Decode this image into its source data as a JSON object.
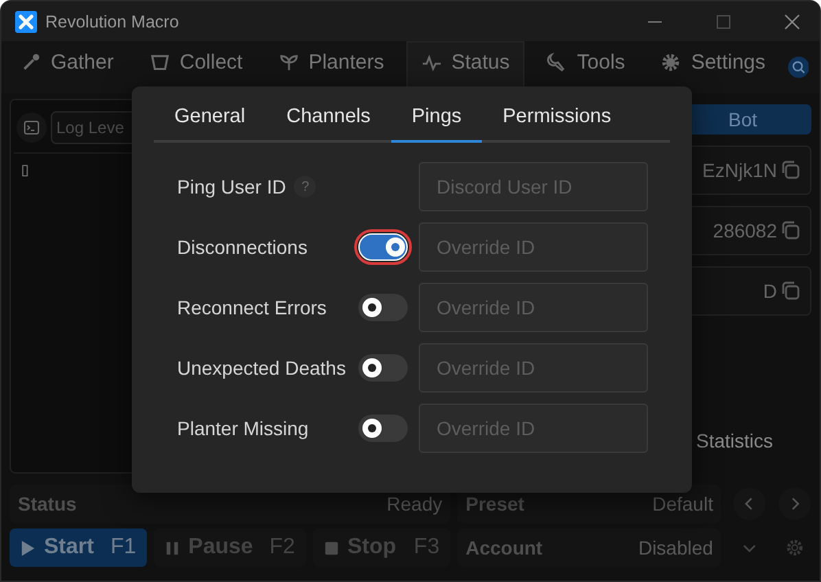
{
  "window": {
    "title": "Revolution Macro"
  },
  "main_tabs": [
    {
      "label": "Gather",
      "selected": false
    },
    {
      "label": "Collect",
      "selected": false
    },
    {
      "label": "Planters",
      "selected": false
    },
    {
      "label": "Status",
      "selected": true
    },
    {
      "label": "Tools",
      "selected": false
    },
    {
      "label": "Settings",
      "selected": false
    }
  ],
  "console": {
    "log_level_placeholder": "Log Leve",
    "output": "▯"
  },
  "bot_panel": {
    "button": "Bot",
    "fields": [
      {
        "value": "EzNjk1N"
      },
      {
        "value": "286082"
      },
      {
        "value": "D"
      }
    ],
    "statistics": "Statistics"
  },
  "dialog": {
    "tabs": [
      {
        "label": "General",
        "selected": false
      },
      {
        "label": "Channels",
        "selected": false
      },
      {
        "label": "Pings",
        "selected": true
      },
      {
        "label": "Permissions",
        "selected": false
      }
    ],
    "rows": [
      {
        "kind": "help",
        "label": "Ping User ID",
        "help": "?",
        "placeholder": "Discord User ID"
      },
      {
        "kind": "toggle",
        "label": "Disconnections",
        "on": true,
        "focused": true,
        "placeholder": "Override ID"
      },
      {
        "kind": "toggle",
        "label": "Reconnect Errors",
        "on": false,
        "focused": false,
        "placeholder": "Override ID"
      },
      {
        "kind": "toggle",
        "label": "Unexpected Deaths",
        "on": false,
        "focused": false,
        "placeholder": "Override ID"
      },
      {
        "kind": "toggle",
        "label": "Planter Missing",
        "on": false,
        "focused": false,
        "placeholder": "Override ID"
      }
    ]
  },
  "status": {
    "label": "Status",
    "value": "Ready"
  },
  "preset": {
    "label": "Preset",
    "value": "Default"
  },
  "controls": [
    {
      "kind": "start",
      "label": "Start",
      "key": "F1"
    },
    {
      "kind": "pause",
      "label": "Pause",
      "key": "F2"
    },
    {
      "kind": "stop",
      "label": "Stop",
      "key": "F3"
    }
  ],
  "account": {
    "label": "Account",
    "value": "Disabled"
  }
}
